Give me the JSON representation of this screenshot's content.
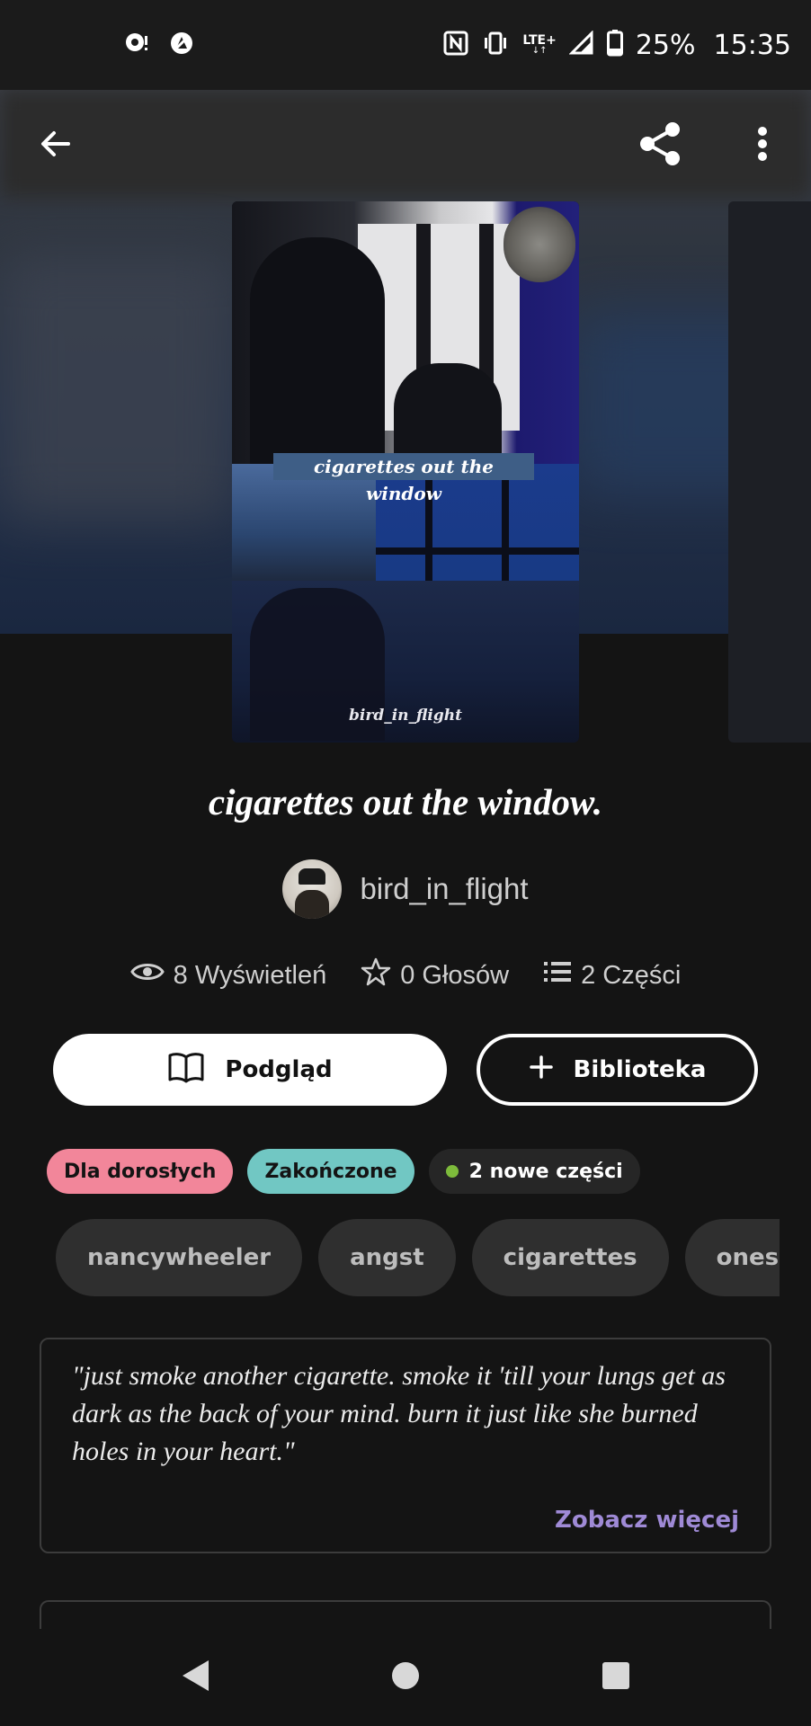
{
  "status_bar": {
    "battery": "25%",
    "time": "15:35",
    "network": "LTE+",
    "icons": [
      "chat-notification-icon",
      "vpn-icon",
      "nfc-icon",
      "vibrate-icon",
      "lte-icon",
      "signal-icon",
      "battery-icon"
    ]
  },
  "toolbar": {
    "icons": [
      "back-arrow-icon",
      "share-icon",
      "more-vert-icon"
    ]
  },
  "cover": {
    "title_text": "cigarettes out the window",
    "author_text": "bird_in_flight"
  },
  "story": {
    "title": "cigarettes out the window.",
    "author": "bird_in_flight",
    "stats": {
      "views": "8 Wyświetleń",
      "votes": "0 Głosów",
      "parts": "2 Części"
    }
  },
  "actions": {
    "preview_label": "Podgląd",
    "library_label": "Biblioteka"
  },
  "badges": {
    "mature": "Dla dorosłych",
    "complete": "Zakończone",
    "new_parts": "2 nowe części"
  },
  "tags": [
    "nancywheeler",
    "angst",
    "cigarettes",
    "oneshot"
  ],
  "description": {
    "text": "\"just smoke another cigarette. smoke it 'till your lungs get as dark as the back of your mind. burn it just like she burned holes in your heart.\"",
    "more_label": "Zobacz więcej"
  },
  "colors": {
    "background": "#141414",
    "mature_badge": "#f2869a",
    "complete_badge": "#71c7c3",
    "new_dot": "#7dbb3b",
    "link": "#9f8ad6"
  },
  "nav_bar": {
    "icons": [
      "nav-back-icon",
      "nav-home-icon",
      "nav-recents-icon"
    ]
  }
}
